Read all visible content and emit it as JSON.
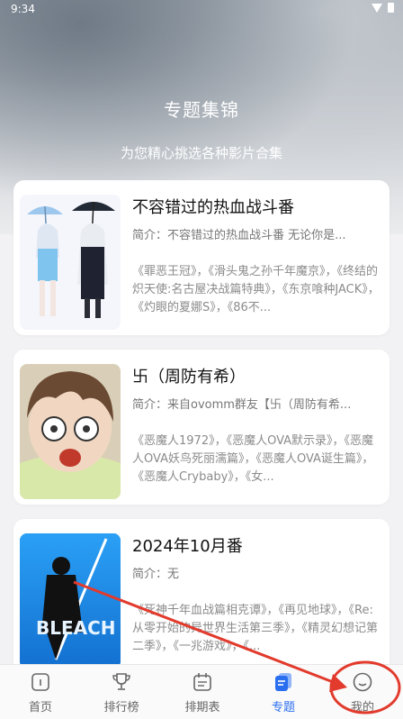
{
  "status_bar": {
    "time": "9:34"
  },
  "header": {
    "title": "专题集锦",
    "subtitle": "为您精心挑选各种影片合集"
  },
  "cards": [
    {
      "title": "不容错过的热血战斗番",
      "intro": "简介：不容错过的热血战斗番 无论你是...",
      "list": "《罪恶王冠》，《滑头鬼之孙千年魔京》，《终结的炽天使:名古屋决战篇特典》，《东京喰种JACK》，《灼眼的夏娜S》，《86不..."
    },
    {
      "title": "卐（周防有希）",
      "intro": "简介：来自ovomm群友【卐（周防有希...",
      "list": "《恶魔人1972》，《恶魔人OVA默示录》，《恶魔人OVA妖鸟死丽濡篇》，《恶魔人OVA诞生篇》，《恶魔人Crybaby》，《女..."
    },
    {
      "title": "2024年10月番",
      "intro": "简介：无",
      "list": "《死神千年血战篇相克谭》，《再见地球》，《Re:从零开始的异世界生活第三季》，《精灵幻想记第二季》，《一兆游戏》，《..."
    }
  ],
  "tabbar": {
    "items": [
      {
        "label": "首页",
        "icon": "home-icon"
      },
      {
        "label": "排行榜",
        "icon": "trophy-icon"
      },
      {
        "label": "排期表",
        "icon": "calendar-icon"
      },
      {
        "label": "专题",
        "icon": "collection-icon"
      },
      {
        "label": "我的",
        "icon": "profile-icon"
      }
    ]
  },
  "colors": {
    "accent": "#2a6ef0",
    "annotation_red": "#e23a2c"
  }
}
